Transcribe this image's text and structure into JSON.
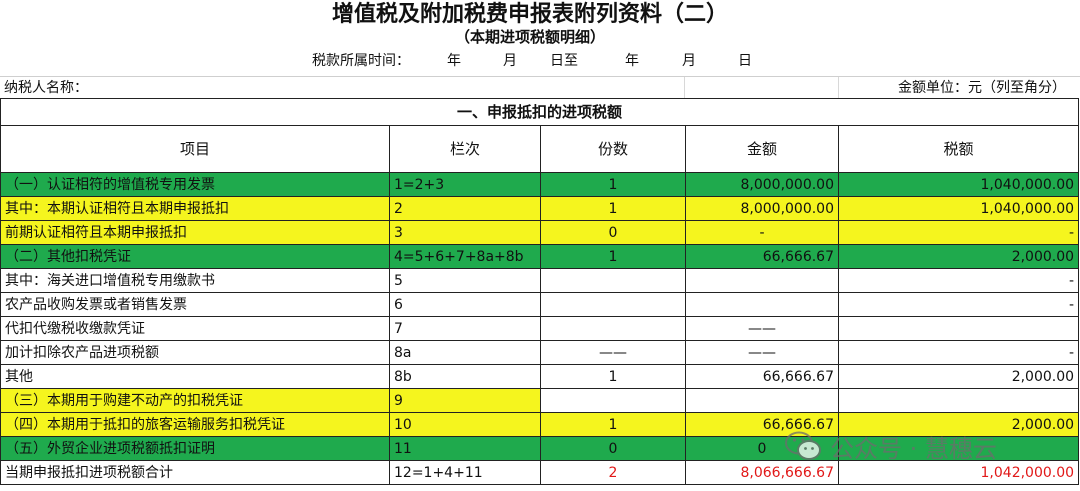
{
  "title": "增值税及附加税费申报表附列资料（二）",
  "subtitle": "（本期进项税额明细）",
  "period": {
    "label": "税款所属时间：",
    "year1": "年",
    "month1": "月",
    "day_to": "日至",
    "year2": "年",
    "month2": "月",
    "day2": "日"
  },
  "info": {
    "taxpayer_label": "纳税人名称：",
    "unit_label": "金额单位：元（列至角分）"
  },
  "section_title": "一、申报抵扣的进项税额",
  "headers": {
    "item": "项目",
    "line": "栏次",
    "count": "份数",
    "amount": "金额",
    "tax": "税额"
  },
  "rows": [
    {
      "item": "（一）认证相符的增值税专用发票",
      "line": "1=2+3",
      "count": "1",
      "amount": "8,000,000.00",
      "tax": "1,040,000.00"
    },
    {
      "item": "其中：本期认证相符且本期申报抵扣",
      "line": "2",
      "count": "1",
      "amount": "8,000,000.00",
      "tax": "1,040,000.00"
    },
    {
      "item": "前期认证相符且本期申报抵扣",
      "line": "3",
      "count": "0",
      "amount": "-",
      "tax": "-"
    },
    {
      "item": "（二）其他扣税凭证",
      "line": "4=5+6+7+8a+8b",
      "count": "1",
      "amount": "66,666.67",
      "tax": "2,000.00"
    },
    {
      "item": "其中：海关进口增值税专用缴款书",
      "line": "5",
      "count": "",
      "amount": "",
      "tax": "-"
    },
    {
      "item": "农产品收购发票或者销售发票",
      "line": "6",
      "count": "",
      "amount": "",
      "tax": "-"
    },
    {
      "item": "代扣代缴税收缴款凭证",
      "line": "7",
      "count": "",
      "amount": "——",
      "tax": ""
    },
    {
      "item": "加计扣除农产品进项税额",
      "line": "8a",
      "count": "——",
      "amount": "——",
      "tax": "-"
    },
    {
      "item": "其他",
      "line": "8b",
      "count": "1",
      "amount": "66,666.67",
      "tax": "2,000.00"
    },
    {
      "item": "（三）本期用于购建不动产的扣税凭证",
      "line": "9",
      "count": "",
      "amount": "",
      "tax": ""
    },
    {
      "item": "（四）本期用于抵扣的旅客运输服务扣税凭证",
      "line": "10",
      "count": "1",
      "amount": "66,666.67",
      "tax": "2,000.00"
    },
    {
      "item": "（五）外贸企业进项税额抵扣证明",
      "line": "11",
      "count": "0",
      "amount": "0",
      "tax": ""
    },
    {
      "item": "当期申报抵扣进项税额合计",
      "line": "12=1+4+11",
      "count": "2",
      "amount": "8,066,666.67",
      "tax": "1,042,000.00"
    }
  ],
  "watermark": "公众号 · 慧穗云",
  "colors": {
    "green": "#1faa4d",
    "yellow": "#f5f51e",
    "red": "#e11818"
  }
}
